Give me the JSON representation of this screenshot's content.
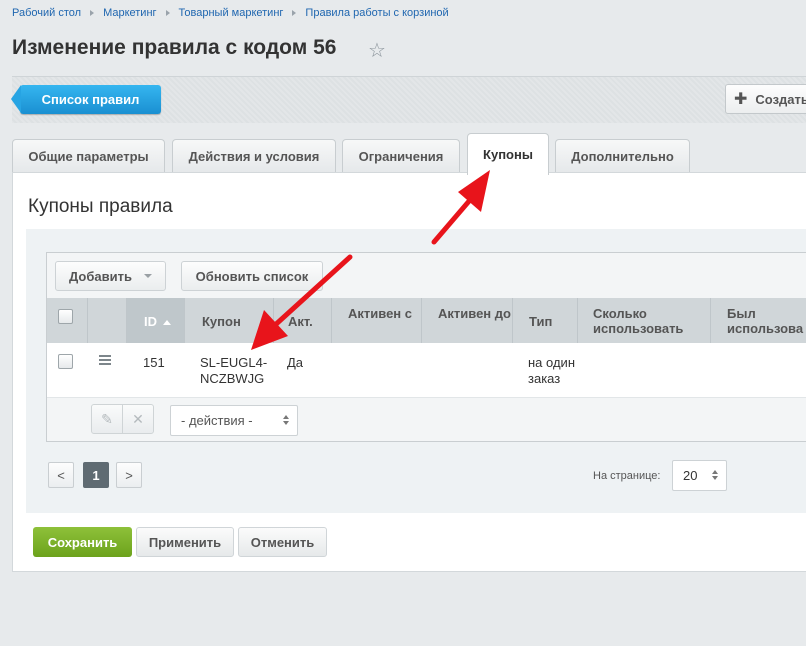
{
  "breadcrumbs": [
    "Рабочий стол",
    "Маркетинг",
    "Товарный маркетинг",
    "Правила работы с корзиной"
  ],
  "page_title": "Изменение правила с кодом 56",
  "toolbar": {
    "list_button": "Список правил",
    "create_button": "Создать"
  },
  "tabs": [
    "Общие параметры",
    "Действия и условия",
    "Ограничения",
    "Купоны",
    "Дополнительно"
  ],
  "active_tab": "Купоны",
  "section_title": "Купоны правила",
  "grid": {
    "add_button": "Добавить",
    "refresh_button": "Обновить список",
    "columns": [
      "ID",
      "Купон",
      "Акт.",
      "Активен с",
      "Активен до",
      "Тип",
      "Сколько использовать",
      "Был использова"
    ],
    "rows": [
      {
        "id": "151",
        "coupon": "SL-EUGL4-NCZBWJG",
        "active": "Да",
        "active_from": "",
        "active_to": "",
        "type": "на один заказ",
        "uses": "",
        "used": ""
      }
    ],
    "actions_select": "- действия -"
  },
  "pagination": {
    "prev": "<",
    "current_page": "1",
    "next": ">",
    "per_page_label": "На странице:",
    "per_page_value": "20"
  },
  "footer": {
    "save": "Сохранить",
    "apply": "Применить",
    "cancel": "Отменить"
  },
  "colors": {
    "accent_blue": "#1a8fd1",
    "save_green": "#6ca21c",
    "arrow_red": "#e8141b"
  }
}
